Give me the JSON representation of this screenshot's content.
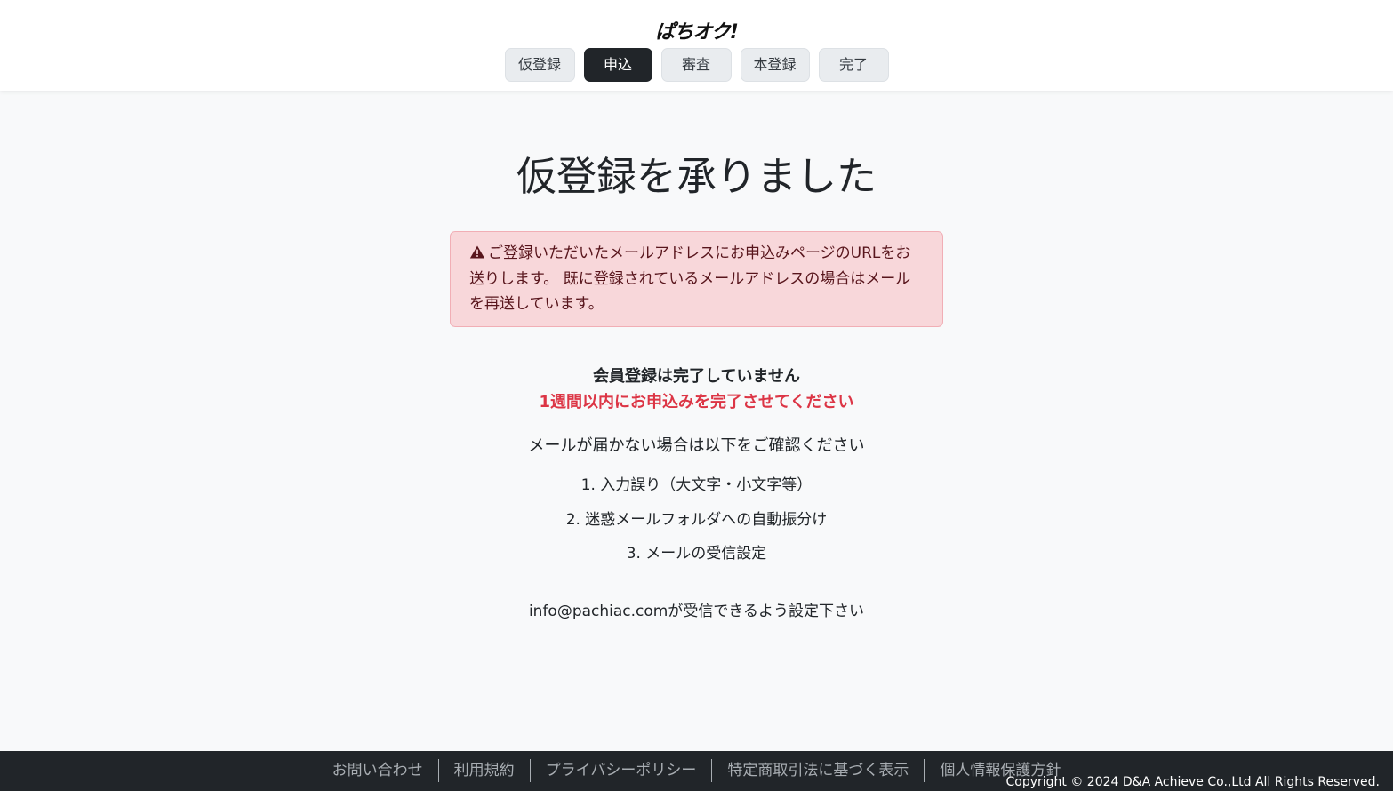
{
  "header": {
    "logo": "ぱちオク!",
    "steps": [
      {
        "label": "仮登録",
        "active": false
      },
      {
        "label": "申込",
        "active": true
      },
      {
        "label": "審査",
        "active": false
      },
      {
        "label": "本登録",
        "active": false
      },
      {
        "label": "完了",
        "active": false
      }
    ]
  },
  "main": {
    "title": "仮登録を承りました",
    "alert": {
      "icon": "warning-triangle-icon",
      "text": "ご登録いただいたメールアドレスにお申込みページのURLをお送りします。 既に登録されているメールアドレスの場合はメールを再送しています。"
    },
    "notice_bold": "会員登録は完了していません",
    "notice_red": "1週間以内にお申込みを完了させてください",
    "check_text": "メールが届かない場合は以下をご確認ください",
    "reasons": [
      "1. 入力誤り（大文字・小文字等）",
      "2. 迷惑メールフォルダへの自動振分け",
      "3. メールの受信設定"
    ],
    "setting_text": "info@pachiac.comが受信できるよう設定下さい"
  },
  "footer": {
    "links": [
      "お問い合わせ",
      "利用規約",
      "プライバシーポリシー",
      "特定商取引法に基づく表示",
      "個人情報保護方針"
    ],
    "copyright": "Copyright © 2024 D&A Achieve Co.,Ltd All Rights Reserved."
  },
  "colors": {
    "active_step": "#212529",
    "alert_bg": "#f8d7da",
    "alert_text": "#58151c",
    "danger": "#dc3545",
    "footer_bg": "#212529"
  }
}
